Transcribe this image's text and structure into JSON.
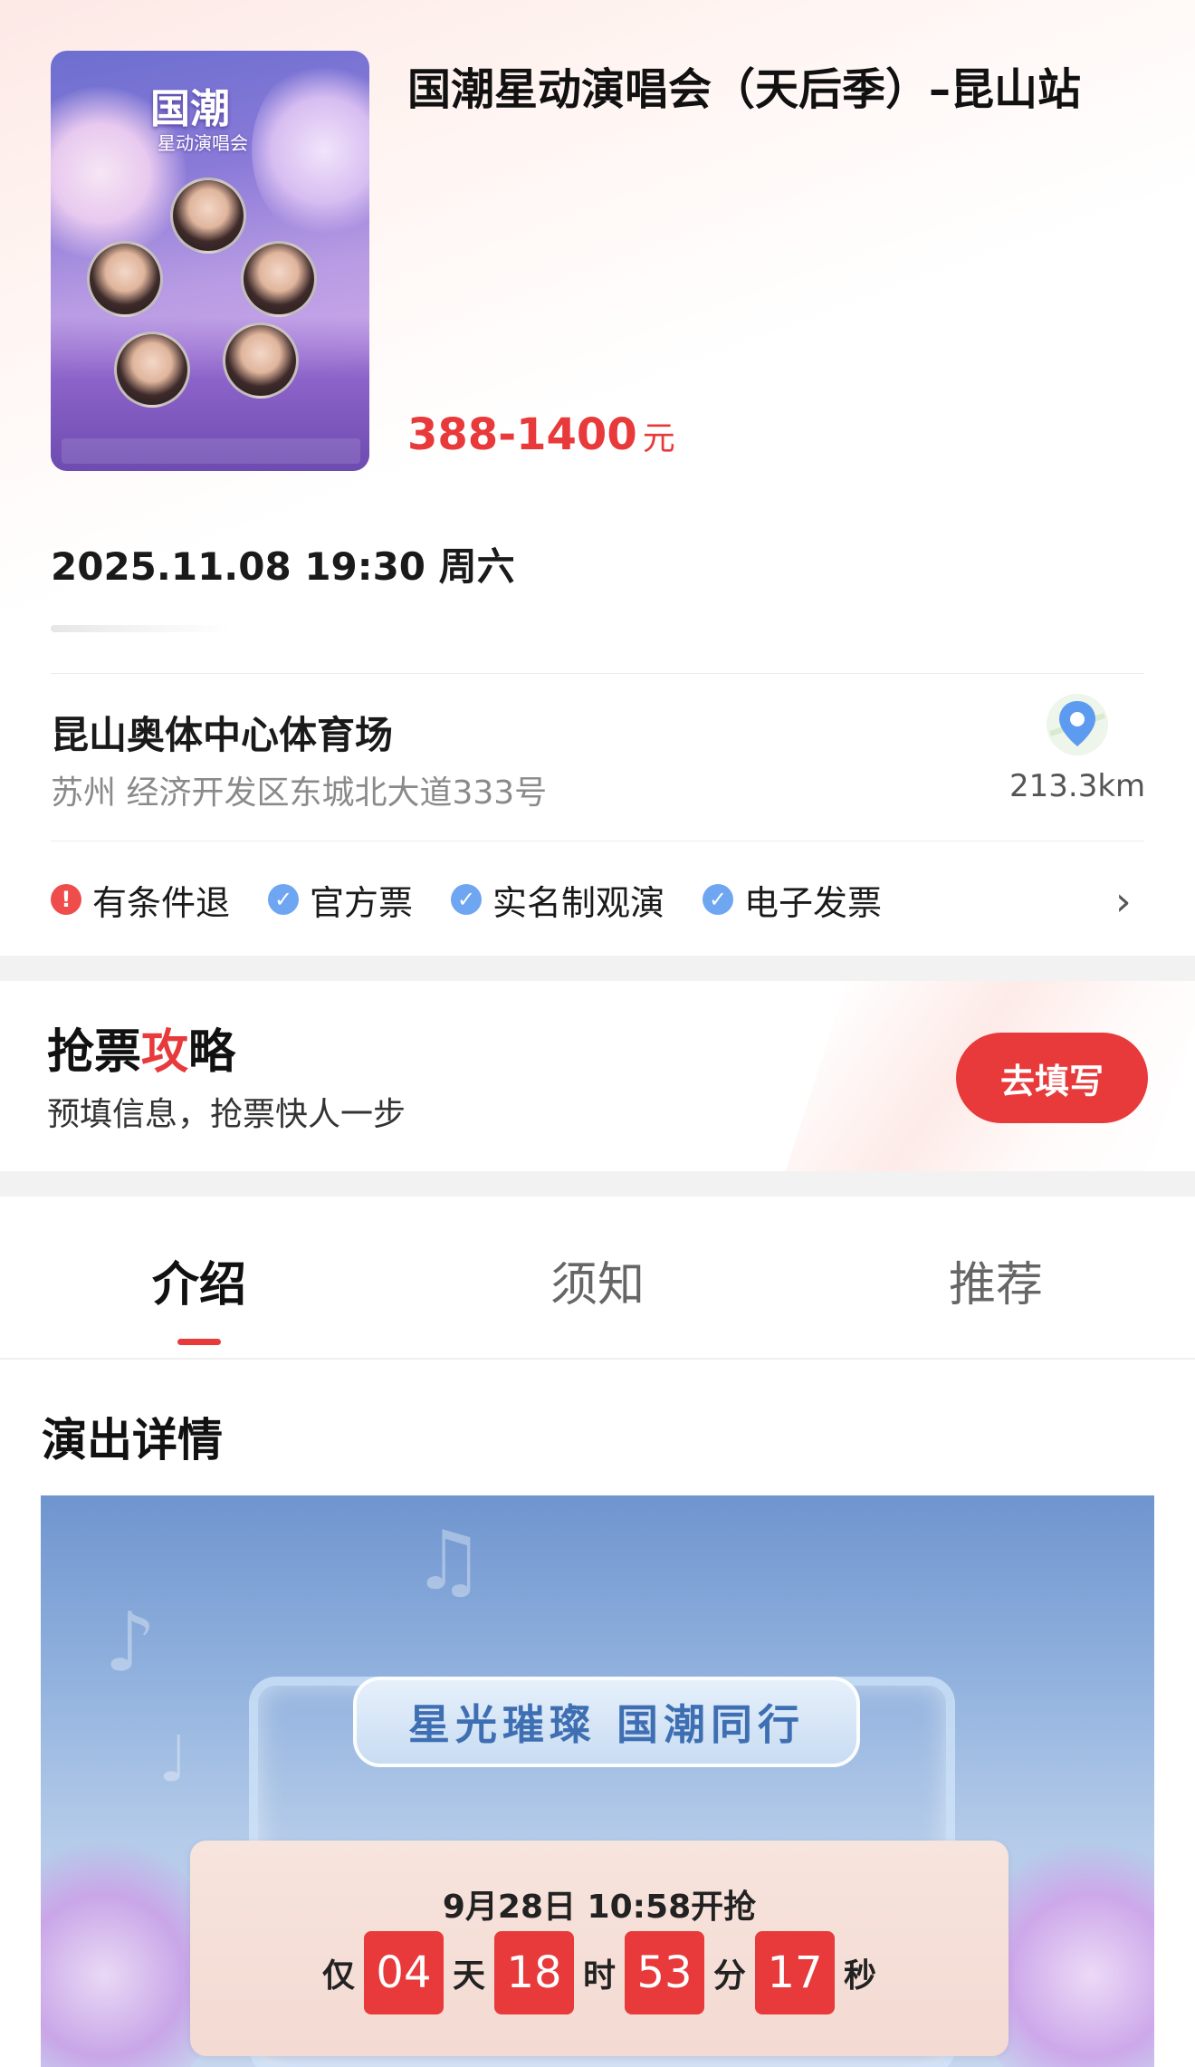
{
  "event": {
    "title": "国潮星动演唱会（天后季）–昆山站",
    "price_range": "388-1400",
    "price_unit": "元",
    "datetime": "2025.11.08 19:30 周六"
  },
  "poster": {
    "logo_big": "国潮",
    "logo_small": "星动演唱会",
    "icon": "poster-image"
  },
  "venue": {
    "name": "昆山奥体中心体育场",
    "address": "苏州 经济开发区东城北大道333号",
    "distance": "213.3km",
    "icon": "map-pin-icon"
  },
  "tags": [
    {
      "label": "有条件退",
      "icon": "warning-icon",
      "kind": "warn"
    },
    {
      "label": "官方票",
      "icon": "check-icon",
      "kind": "ok"
    },
    {
      "label": "实名制观演",
      "icon": "check-icon",
      "kind": "ok"
    },
    {
      "label": "电子发票",
      "icon": "check-icon",
      "kind": "ok"
    }
  ],
  "strategy": {
    "title_a": "抢票",
    "title_b": "攻",
    "title_c": "略",
    "subtitle": "预填信息，抢票快人一步",
    "button": "去填写"
  },
  "tabs": [
    {
      "label": "介绍",
      "active": true
    },
    {
      "label": "须知",
      "active": false
    },
    {
      "label": "推荐",
      "active": false
    }
  ],
  "detail": {
    "heading": "演出详情",
    "slogan": "星光璀璨  国潮同行"
  },
  "countdown": {
    "open_text": "9月28日  10:58开抢",
    "prefix": "仅",
    "days": "04",
    "days_label": "天",
    "hours": "18",
    "hours_label": "时",
    "minutes": "53",
    "minutes_label": "分",
    "seconds": "17",
    "seconds_label": "秒"
  },
  "colors": {
    "accent": "#e8393b",
    "check": "#6fa6f1"
  }
}
